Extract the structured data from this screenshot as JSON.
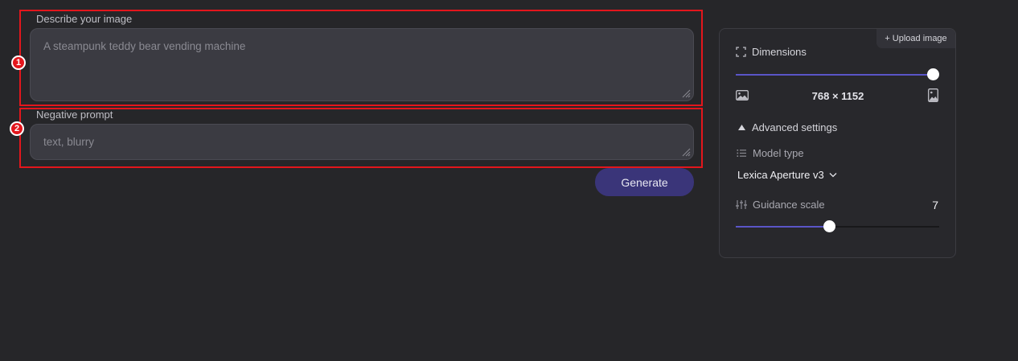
{
  "prompt": {
    "label": "Describe your image",
    "placeholder": "A steampunk teddy bear vending machine",
    "badge": "1"
  },
  "negative_prompt": {
    "label": "Negative prompt",
    "placeholder": "text, blurry",
    "badge": "2"
  },
  "generate_label": "Generate",
  "settings": {
    "upload_label": "+ Upload image",
    "dimensions": {
      "label": "Dimensions",
      "value": "768 × 1152",
      "slider_fraction": 1.0
    },
    "advanced_label": "Advanced settings",
    "model_type": {
      "label": "Model type",
      "selected": "Lexica Aperture v3"
    },
    "guidance_scale": {
      "label": "Guidance scale",
      "value": "7",
      "slider_fraction": 0.46
    }
  },
  "colors": {
    "annotation": "#e3161c",
    "accent": "#5a55c8",
    "generate_bg": "#3a3579"
  },
  "icons": [
    "expand-icon",
    "landscape-image-icon",
    "portrait-image-icon",
    "triangle-up-icon",
    "list-icon",
    "chevron-down-icon",
    "sliders-icon",
    "resize-grip-icon"
  ]
}
